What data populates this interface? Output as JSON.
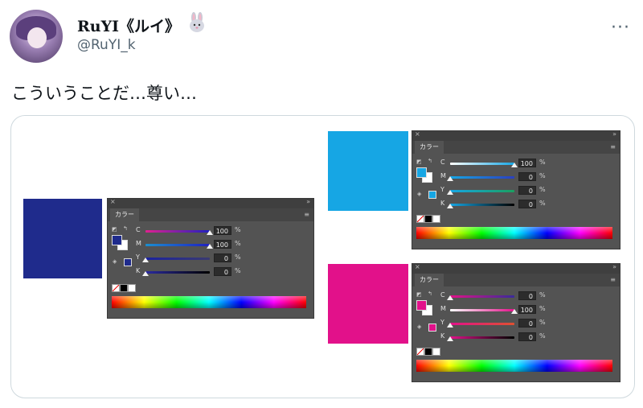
{
  "tweet": {
    "display_name": "RuYI《ルイ》",
    "handle": "@RuYI_k",
    "text": "こういうことだ…尊い…",
    "more_label": "···"
  },
  "panels": [
    {
      "id": "navy",
      "tab_label": "カラー",
      "swatch_color": "#1f2b8c",
      "channels": [
        {
          "label": "C",
          "value": "100",
          "unit": "%",
          "gradient": "linear-gradient(to right,#e02090,#2020c0)"
        },
        {
          "label": "M",
          "value": "100",
          "unit": "%",
          "gradient": "linear-gradient(to right,#1a8fd0,#2020c0)"
        },
        {
          "label": "Y",
          "value": "0",
          "unit": "%",
          "gradient": "linear-gradient(to right,#1a22a0,#3a3a70)"
        },
        {
          "label": "K",
          "value": "0",
          "unit": "%",
          "gradient": "linear-gradient(to right,#2a2aa0,#000000)"
        }
      ]
    },
    {
      "id": "cyan",
      "tab_label": "カラー",
      "swatch_color": "#16a6e4",
      "channels": [
        {
          "label": "C",
          "value": "100",
          "unit": "%",
          "gradient": "linear-gradient(to right,#ffffff,#16a6e4)"
        },
        {
          "label": "M",
          "value": "0",
          "unit": "%",
          "gradient": "linear-gradient(to right,#16a6e4,#2a3fc0)"
        },
        {
          "label": "Y",
          "value": "0",
          "unit": "%",
          "gradient": "linear-gradient(to right,#16a6e4,#1aa060)"
        },
        {
          "label": "K",
          "value": "0",
          "unit": "%",
          "gradient": "linear-gradient(to right,#16a6e4,#000000)"
        }
      ]
    },
    {
      "id": "magenta",
      "tab_label": "カラー",
      "swatch_color": "#e2118a",
      "channels": [
        {
          "label": "C",
          "value": "0",
          "unit": "%",
          "gradient": "linear-gradient(to right,#e2118a,#3a2a9a)"
        },
        {
          "label": "M",
          "value": "100",
          "unit": "%",
          "gradient": "linear-gradient(to right,#ffffff,#e2118a)"
        },
        {
          "label": "Y",
          "value": "0",
          "unit": "%",
          "gradient": "linear-gradient(to right,#e2118a,#e05030)"
        },
        {
          "label": "K",
          "value": "0",
          "unit": "%",
          "gradient": "linear-gradient(to right,#e2118a,#000000)"
        }
      ]
    }
  ]
}
